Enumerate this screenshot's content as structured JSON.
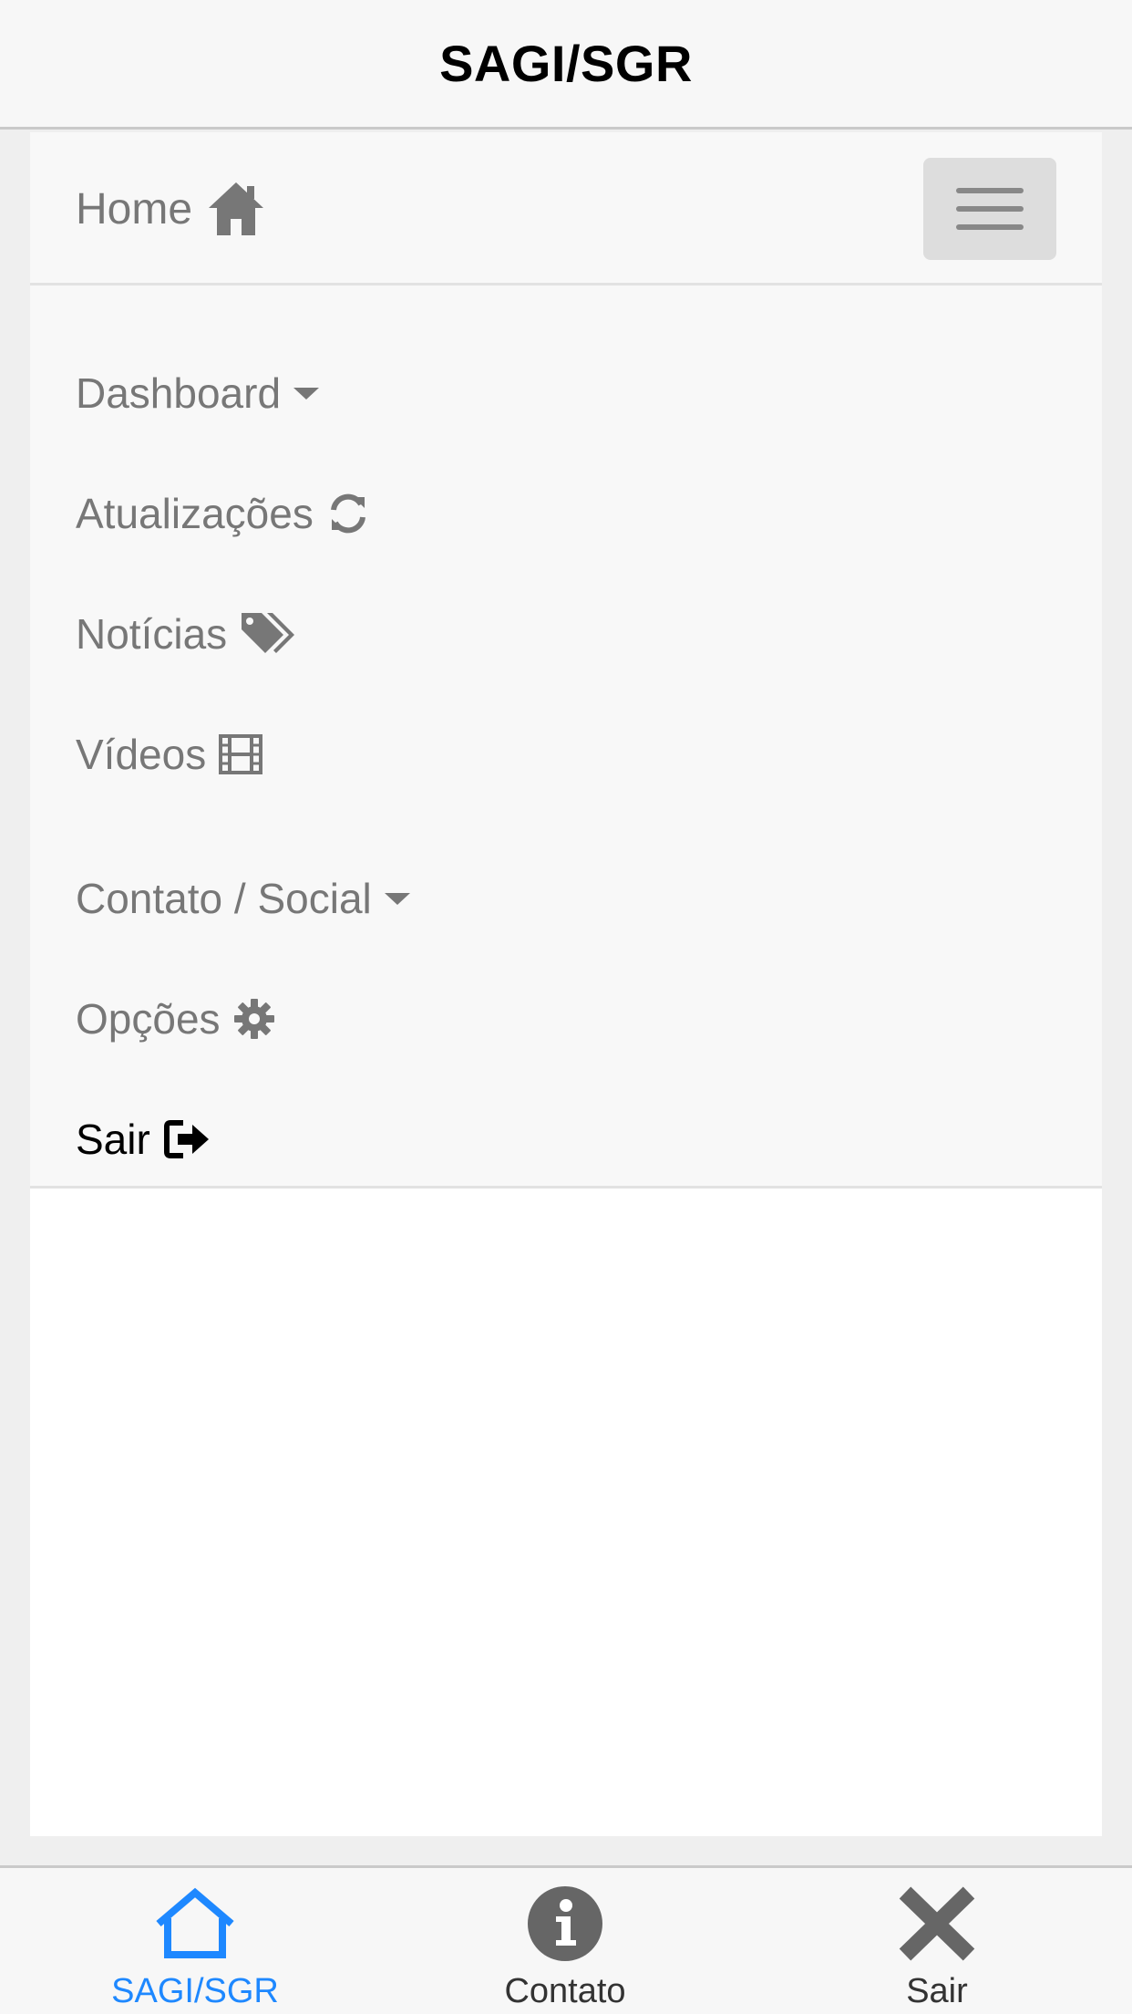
{
  "header": {
    "title": "SAGI/SGR"
  },
  "navbar": {
    "brand_label": "Home",
    "items": [
      {
        "label": "Dashboard",
        "icon": "caret-down-icon"
      },
      {
        "label": "Atualizações",
        "icon": "refresh-icon"
      },
      {
        "label": "Notícias",
        "icon": "tags-icon"
      },
      {
        "label": "Vídeos",
        "icon": "film-icon"
      },
      {
        "label": "Contato / Social",
        "icon": "caret-down-icon"
      },
      {
        "label": "Opções",
        "icon": "gear-icon"
      },
      {
        "label": "Sair",
        "icon": "sign-out-icon"
      }
    ]
  },
  "tabbar": {
    "tabs": [
      {
        "label": "SAGI/SGR",
        "icon": "home-outline-icon",
        "active": true
      },
      {
        "label": "Contato",
        "icon": "info-circle-icon",
        "active": false
      },
      {
        "label": "Sair",
        "icon": "close-x-icon",
        "active": false
      }
    ]
  },
  "colors": {
    "accent": "#1e88ff",
    "nav_text": "#777777",
    "nav_bg": "#f8f8f8",
    "page_bg": "#efefef"
  }
}
